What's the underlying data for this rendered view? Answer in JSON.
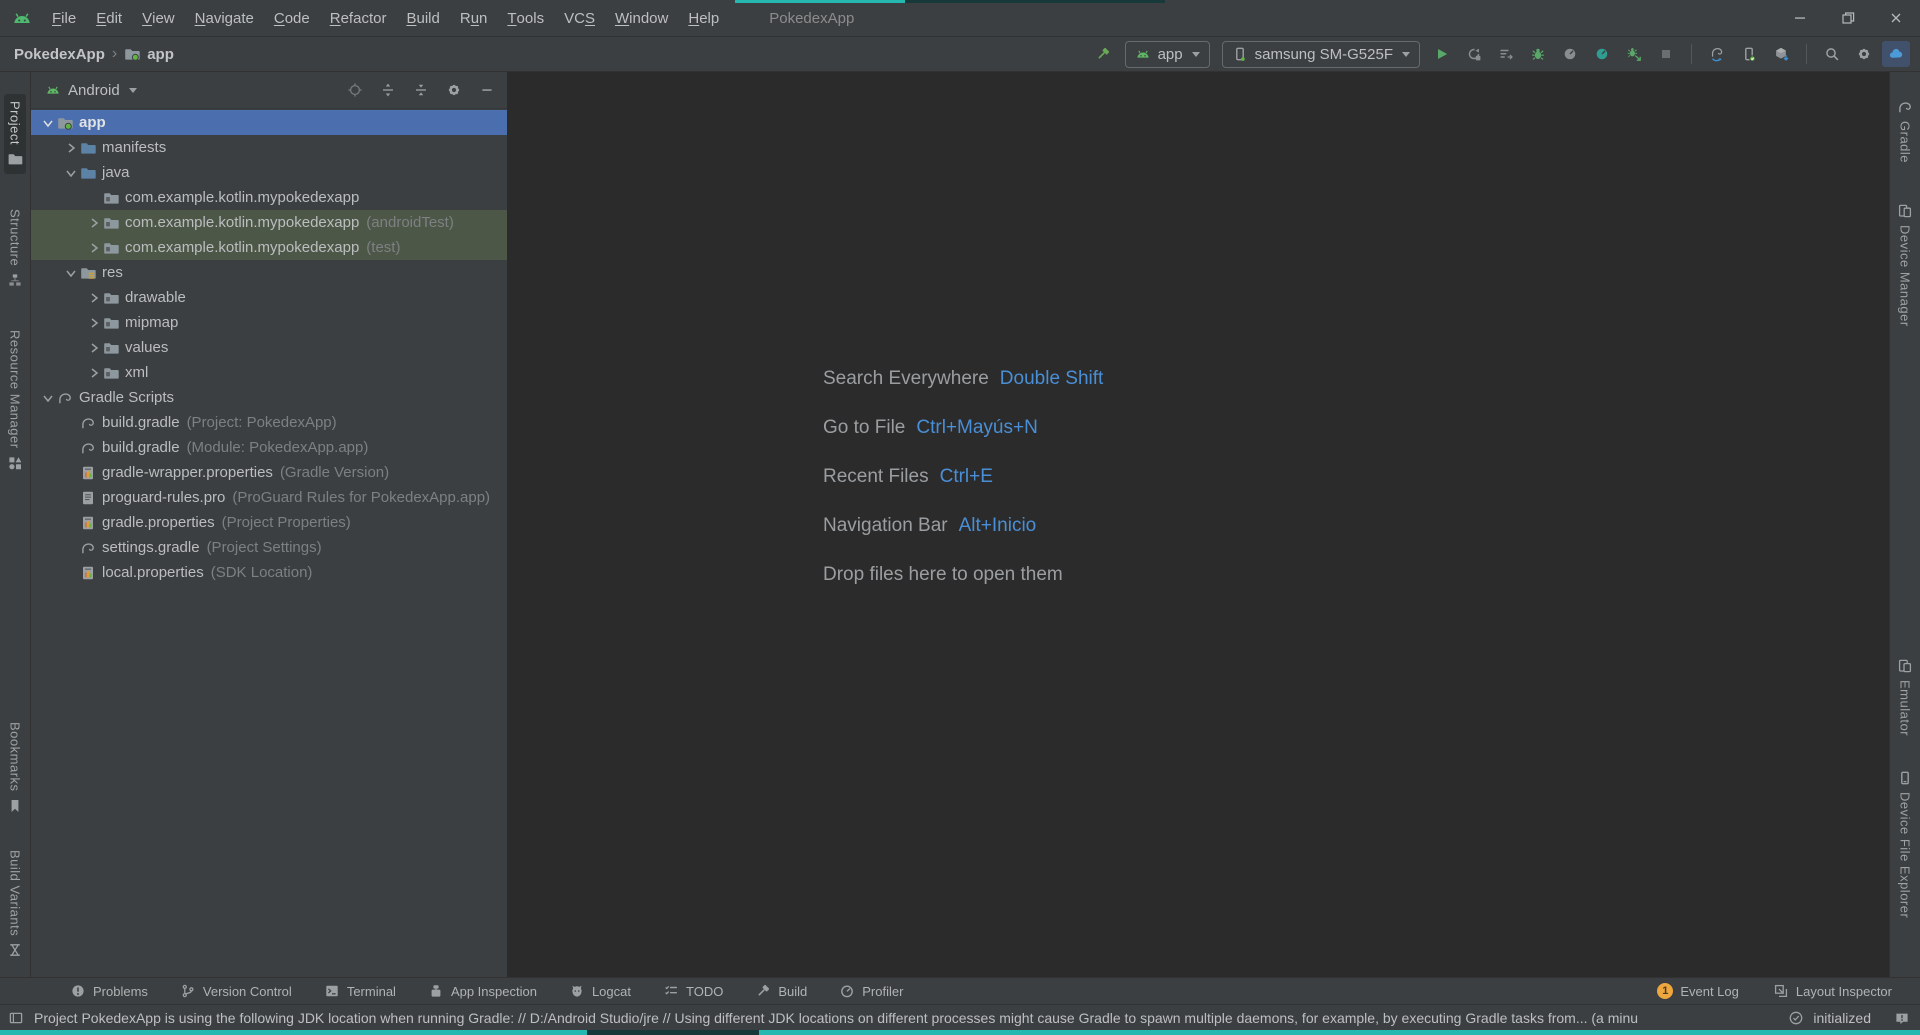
{
  "window": {
    "title": "PokedexApp",
    "controls": [
      {
        "name": "minimize"
      },
      {
        "name": "restore"
      },
      {
        "name": "close"
      }
    ]
  },
  "menubar": {
    "items": [
      {
        "label": "File",
        "mnemonic": 0
      },
      {
        "label": "Edit",
        "mnemonic": 0
      },
      {
        "label": "View",
        "mnemonic": 0
      },
      {
        "label": "Navigate",
        "mnemonic": 0
      },
      {
        "label": "Code",
        "mnemonic": 0
      },
      {
        "label": "Refactor",
        "mnemonic": 0
      },
      {
        "label": "Build",
        "mnemonic": 0
      },
      {
        "label": "Run",
        "mnemonic": 1
      },
      {
        "label": "Tools",
        "mnemonic": 0
      },
      {
        "label": "VCS",
        "mnemonic": 2
      },
      {
        "label": "Window",
        "mnemonic": 0
      },
      {
        "label": "Help",
        "mnemonic": 0
      }
    ]
  },
  "toolbar": {
    "breadcrumb": {
      "project": "PokedexApp",
      "separator": "›",
      "module": "app"
    },
    "run_config": {
      "label": "app"
    },
    "device": {
      "label": "samsung SM-G525F"
    },
    "actions": [
      {
        "name": "build-hammer"
      },
      {
        "name": "run-config-combo"
      },
      {
        "name": "device-combo"
      },
      {
        "name": "run"
      },
      {
        "name": "apply-changes-restart",
        "state": "disabled"
      },
      {
        "name": "apply-code-changes",
        "state": "disabled"
      },
      {
        "name": "debug"
      },
      {
        "name": "profile",
        "state": "disabled"
      },
      {
        "name": "profiler"
      },
      {
        "name": "attach-debugger"
      },
      {
        "name": "stop",
        "state": "disabled"
      },
      {
        "name": "separator"
      },
      {
        "name": "gradle-sync"
      },
      {
        "name": "device-manager"
      },
      {
        "name": "sdk-manager"
      },
      {
        "name": "separator"
      },
      {
        "name": "search-everywhere"
      },
      {
        "name": "settings"
      },
      {
        "name": "assistant",
        "state": "active"
      }
    ]
  },
  "left_stripe": {
    "top": [
      {
        "label": "Project",
        "icon": "project-folder",
        "active": true
      },
      {
        "label": "Structure",
        "icon": "structure"
      },
      {
        "label": "Resource Manager",
        "icon": "resource-manager"
      }
    ],
    "bottom": [
      {
        "label": "Bookmarks",
        "icon": "bookmark"
      },
      {
        "label": "Build Variants",
        "icon": "build-variants"
      }
    ]
  },
  "right_stripe": {
    "top": [
      {
        "label": "Gradle",
        "icon": "gradle"
      },
      {
        "label": "Device Manager",
        "icon": "device-manager-stripe"
      }
    ],
    "bottom": [
      {
        "label": "Emulator",
        "icon": "emulator"
      },
      {
        "label": "Device File Explorer",
        "icon": "device-file-explorer"
      }
    ]
  },
  "project_panel": {
    "header": {
      "view": "Android",
      "icons": [
        "locate",
        "expand-all",
        "collapse-all",
        "settings-gear",
        "hide"
      ]
    },
    "tree": [
      {
        "label": "app",
        "level": 0,
        "chevron": "down",
        "icon": "module-folder",
        "state": "selected"
      },
      {
        "label": "manifests",
        "level": 1,
        "chevron": "right",
        "icon": "folder-blue"
      },
      {
        "label": "java",
        "level": 1,
        "chevron": "down",
        "icon": "folder-blue"
      },
      {
        "label": "com.example.kotlin.mypokedexapp",
        "level": 2,
        "chevron": "none",
        "icon": "package"
      },
      {
        "label": "com.example.kotlin.mypokedexapp",
        "suffix": "(androidTest)",
        "level": 2,
        "chevron": "right",
        "icon": "package",
        "state": "testrow"
      },
      {
        "label": "com.example.kotlin.mypokedexapp",
        "suffix": "(test)",
        "level": 2,
        "chevron": "right",
        "icon": "package",
        "state": "testrow"
      },
      {
        "label": "res",
        "level": 1,
        "chevron": "down",
        "icon": "res-folder"
      },
      {
        "label": "drawable",
        "level": 2,
        "chevron": "right",
        "icon": "package"
      },
      {
        "label": "mipmap",
        "level": 2,
        "chevron": "right",
        "icon": "package"
      },
      {
        "label": "values",
        "level": 2,
        "chevron": "right",
        "icon": "package"
      },
      {
        "label": "xml",
        "level": 2,
        "chevron": "right",
        "icon": "package"
      },
      {
        "label": "Gradle Scripts",
        "level": 0,
        "chevron": "down",
        "icon": "gradle"
      },
      {
        "label": "build.gradle",
        "suffix": "(Project: PokedexApp)",
        "level": 1,
        "chevron": "none",
        "icon": "gradle"
      },
      {
        "label": "build.gradle",
        "suffix": "(Module: PokedexApp.app)",
        "level": 1,
        "chevron": "none",
        "icon": "gradle"
      },
      {
        "label": "gradle-wrapper.properties",
        "suffix": "(Gradle Version)",
        "level": 1,
        "chevron": "none",
        "icon": "properties"
      },
      {
        "label": "proguard-rules.pro",
        "suffix": "(ProGuard Rules for PokedexApp.app)",
        "level": 1,
        "chevron": "none",
        "icon": "textfile"
      },
      {
        "label": "gradle.properties",
        "suffix": "(Project Properties)",
        "level": 1,
        "chevron": "none",
        "icon": "properties"
      },
      {
        "label": "settings.gradle",
        "suffix": "(Project Settings)",
        "level": 1,
        "chevron": "none",
        "icon": "gradle"
      },
      {
        "label": "local.properties",
        "suffix": "(SDK Location)",
        "level": 1,
        "chevron": "none",
        "icon": "properties"
      }
    ]
  },
  "editor_hints": [
    {
      "label": "Search Everywhere",
      "shortcut": "Double Shift"
    },
    {
      "label": "Go to File",
      "shortcut": "Ctrl+Mayús+N"
    },
    {
      "label": "Recent Files",
      "shortcut": "Ctrl+E"
    },
    {
      "label": "Navigation Bar",
      "shortcut": "Alt+Inicio"
    },
    {
      "label": "Drop files here to open them",
      "shortcut": ""
    }
  ],
  "bottom_bar": {
    "left": [
      {
        "label": "Problems",
        "icon": "problems"
      },
      {
        "label": "Version Control",
        "icon": "version-control"
      },
      {
        "label": "Terminal",
        "icon": "terminal"
      },
      {
        "label": "App Inspection",
        "icon": "app-inspection"
      },
      {
        "label": "Logcat",
        "icon": "logcat"
      },
      {
        "label": "TODO",
        "icon": "todo"
      },
      {
        "label": "Build",
        "icon": "build-hammer-gray"
      },
      {
        "label": "Profiler",
        "icon": "profiler-gray"
      }
    ],
    "right": [
      {
        "label": "Event Log",
        "icon": "event-log",
        "badge": "1"
      },
      {
        "label": "Layout Inspector",
        "icon": "layout-inspector"
      }
    ]
  },
  "status_bar": {
    "message": "Project PokedexApp is using the following JDK location when running Gradle: // D:/Android Studio/jre // Using different JDK locations on different processes might cause Gradle to spawn multiple daemons, for example, by executing Gradle tasks from... (a minu",
    "initialized": "initialized"
  },
  "colors": {
    "accent_teal": "#25b8b0",
    "selection_blue": "#4b6eaf",
    "test_row_green": "#4c5748",
    "shortcut_blue": "#4a8fd6",
    "badge_orange": "#eda73e",
    "android_green": "#4fba6f",
    "panel_bg": "#3c3f41",
    "editor_bg": "#2b2b2b"
  }
}
